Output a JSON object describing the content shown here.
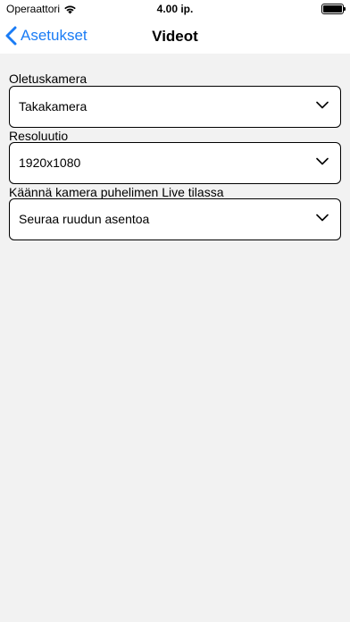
{
  "status_bar": {
    "carrier": "Operaattori",
    "time": "4.00 ip.",
    "battery_level": 1.0
  },
  "nav": {
    "back_label": "Asetukset",
    "title": "Videot"
  },
  "settings": [
    {
      "label": "Oletuskamera",
      "value": "Takakamera"
    },
    {
      "label": "Resoluutio",
      "value": "1920x1080"
    },
    {
      "label": "Käännä kamera puhelimen Live tilassa",
      "value": "Seuraa ruudun asentoa"
    }
  ],
  "colors": {
    "accent": "#1a7cf5",
    "background": "#f2f2f2",
    "surface": "#ffffff"
  }
}
